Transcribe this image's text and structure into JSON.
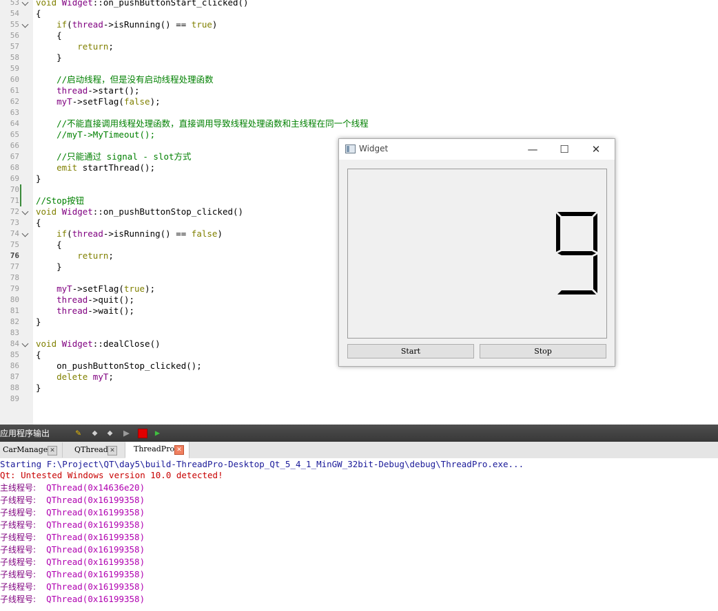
{
  "editor": {
    "current_line": "76",
    "lines": [
      {
        "n": "53",
        "fold": true,
        "t": [
          [
            "kw",
            "void "
          ],
          [
            "cls",
            "Widget"
          ],
          [
            "",
            "::on_pushButtonStart_clicked()"
          ]
        ]
      },
      {
        "n": "54",
        "t": [
          [
            "",
            "{"
          ]
        ]
      },
      {
        "n": "55",
        "fold": true,
        "t": [
          [
            "",
            "    "
          ],
          [
            "kw",
            "if"
          ],
          [
            "",
            "("
          ],
          [
            "cls",
            "thread"
          ],
          [
            "",
            "->isRunning() == "
          ],
          [
            "kw",
            "true"
          ],
          [
            "",
            ")"
          ]
        ]
      },
      {
        "n": "56",
        "t": [
          [
            "",
            "    {"
          ]
        ]
      },
      {
        "n": "57",
        "t": [
          [
            "",
            "        "
          ],
          [
            "kw",
            "return"
          ],
          [
            "",
            ";"
          ]
        ]
      },
      {
        "n": "58",
        "t": [
          [
            "",
            "    }"
          ]
        ]
      },
      {
        "n": "59",
        "t": []
      },
      {
        "n": "60",
        "t": [
          [
            "",
            "    "
          ],
          [
            "cm",
            "//启动线程，但是没有启动线程处理函数"
          ]
        ]
      },
      {
        "n": "61",
        "t": [
          [
            "",
            "    "
          ],
          [
            "cls",
            "thread"
          ],
          [
            "",
            "->start();"
          ]
        ]
      },
      {
        "n": "62",
        "t": [
          [
            "",
            "    "
          ],
          [
            "cls",
            "myT"
          ],
          [
            "",
            "->setFlag("
          ],
          [
            "kw",
            "false"
          ],
          [
            "",
            ");"
          ]
        ]
      },
      {
        "n": "63",
        "t": []
      },
      {
        "n": "64",
        "t": [
          [
            "",
            "    "
          ],
          [
            "cm",
            "//不能直接调用线程处理函数，直接调用导致线程处理函数和主线程在同一个线程"
          ]
        ]
      },
      {
        "n": "65",
        "t": [
          [
            "",
            "    "
          ],
          [
            "cm",
            "//myT->MyTimeout();"
          ]
        ]
      },
      {
        "n": "66",
        "t": []
      },
      {
        "n": "67",
        "t": [
          [
            "",
            "    "
          ],
          [
            "cm",
            "//只能通过 signal - slot方式"
          ]
        ]
      },
      {
        "n": "68",
        "t": [
          [
            "",
            "    "
          ],
          [
            "kw",
            "emit "
          ],
          [
            "",
            "startThread();"
          ]
        ]
      },
      {
        "n": "69",
        "t": [
          [
            "",
            "}"
          ]
        ]
      },
      {
        "n": "70",
        "mark": true,
        "t": []
      },
      {
        "n": "71",
        "mark": true,
        "t": [
          [
            "cm",
            "//Stop按钮"
          ]
        ]
      },
      {
        "n": "72",
        "fold": true,
        "t": [
          [
            "kw",
            "void "
          ],
          [
            "cls",
            "Widget"
          ],
          [
            "",
            "::on_pushButtonStop_clicked()"
          ]
        ]
      },
      {
        "n": "73",
        "t": [
          [
            "",
            "{"
          ]
        ]
      },
      {
        "n": "74",
        "fold": true,
        "t": [
          [
            "",
            "    "
          ],
          [
            "kw",
            "if"
          ],
          [
            "",
            "("
          ],
          [
            "cls",
            "thread"
          ],
          [
            "",
            "->isRunning() == "
          ],
          [
            "kw",
            "false"
          ],
          [
            "",
            ")"
          ]
        ]
      },
      {
        "n": "75",
        "t": [
          [
            "",
            "    {"
          ]
        ]
      },
      {
        "n": "76",
        "t": [
          [
            "",
            "        "
          ],
          [
            "kw",
            "return"
          ],
          [
            "",
            ";"
          ]
        ]
      },
      {
        "n": "77",
        "t": [
          [
            "",
            "    }"
          ]
        ]
      },
      {
        "n": "78",
        "t": []
      },
      {
        "n": "79",
        "t": [
          [
            "",
            "    "
          ],
          [
            "cls",
            "myT"
          ],
          [
            "",
            "->setFlag("
          ],
          [
            "kw",
            "true"
          ],
          [
            "",
            ");"
          ]
        ]
      },
      {
        "n": "80",
        "t": [
          [
            "",
            "    "
          ],
          [
            "cls",
            "thread"
          ],
          [
            "",
            "->quit();"
          ]
        ]
      },
      {
        "n": "81",
        "t": [
          [
            "",
            "    "
          ],
          [
            "cls",
            "thread"
          ],
          [
            "",
            "->wait();"
          ]
        ]
      },
      {
        "n": "82",
        "t": [
          [
            "",
            "}"
          ]
        ]
      },
      {
        "n": "83",
        "t": []
      },
      {
        "n": "84",
        "fold": true,
        "t": [
          [
            "kw",
            "void "
          ],
          [
            "cls",
            "Widget"
          ],
          [
            "",
            "::dealClose()"
          ]
        ]
      },
      {
        "n": "85",
        "t": [
          [
            "",
            "{"
          ]
        ]
      },
      {
        "n": "86",
        "t": [
          [
            "",
            "    on_pushButtonStop_clicked();"
          ]
        ]
      },
      {
        "n": "87",
        "t": [
          [
            "",
            "    "
          ],
          [
            "kw",
            "delete "
          ],
          [
            "cls",
            "myT"
          ],
          [
            "",
            ";"
          ]
        ]
      },
      {
        "n": "88",
        "t": [
          [
            "",
            "}"
          ]
        ]
      },
      {
        "n": "89",
        "t": []
      }
    ]
  },
  "widget_window": {
    "title": "Widget",
    "minimize_symbol": "—",
    "maximize_symbol": "☐",
    "close_symbol": "✕",
    "lcd_value": "9",
    "start_label": "Start",
    "stop_label": "Stop"
  },
  "output_pane": {
    "title": "应用程序输出",
    "tabs": [
      {
        "label": "CarManager",
        "active": false
      },
      {
        "label": "QThread",
        "active": false
      },
      {
        "label": "ThreadPro",
        "active": true
      }
    ],
    "start_line": "Starting F:\\Project\\QT\\day5\\build-ThreadPro-Desktop_Qt_5_4_1_MinGW_32bit-Debug\\debug\\ThreadPro.exe...",
    "warning_line": "Qt: Untested Windows version 10.0 detected!",
    "lines": [
      {
        "label": "主线程号:",
        "value": "QThread(0x14636e20)"
      },
      {
        "label": "子线程号:",
        "value": "QThread(0x16199358)"
      },
      {
        "label": "子线程号:",
        "value": "QThread(0x16199358)"
      },
      {
        "label": "子线程号:",
        "value": "QThread(0x16199358)"
      },
      {
        "label": "子线程号:",
        "value": "QThread(0x16199358)"
      },
      {
        "label": "子线程号:",
        "value": "QThread(0x16199358)"
      },
      {
        "label": "子线程号:",
        "value": "QThread(0x16199358)"
      },
      {
        "label": "子线程号:",
        "value": "QThread(0x16199358)"
      },
      {
        "label": "子线程号:",
        "value": "QThread(0x16199358)"
      },
      {
        "label": "子线程号:",
        "value": "QThread(0x16199358)"
      }
    ]
  }
}
